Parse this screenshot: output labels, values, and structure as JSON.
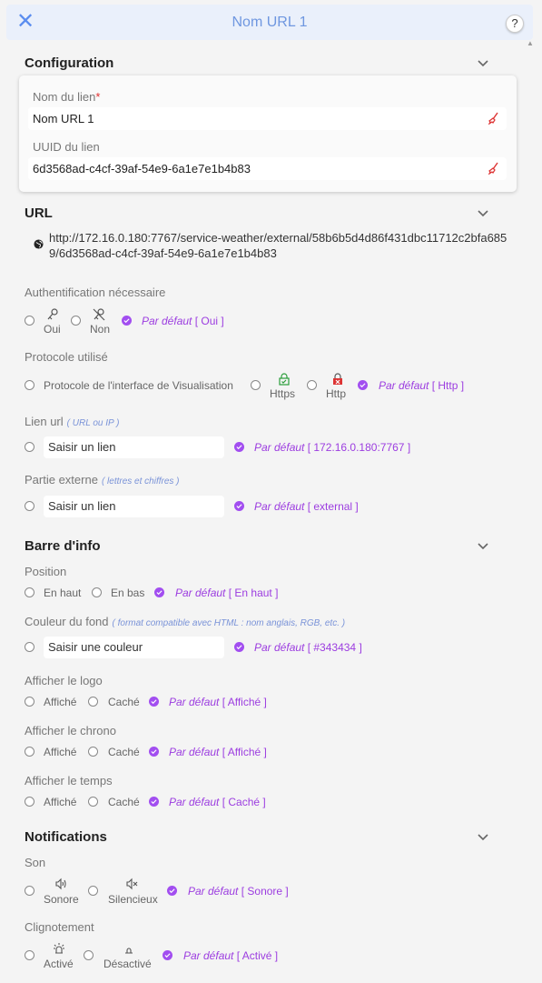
{
  "header": {
    "title": "Nom URL 1",
    "close_icon": "close-icon",
    "help_label": "?"
  },
  "config": {
    "title": "Configuration",
    "name_label": "Nom du lien",
    "required_mark": "*",
    "name_value": "Nom URL 1",
    "uuid_label": "UUID du lien",
    "uuid_value": "6d3568ad-c4cf-39af-54e9-6a1e7e1b4b83"
  },
  "url": {
    "title": "URL",
    "value": "http://172.16.0.180:7767/service-weather/external/58b6b5d4d86f431dbc11712c2bfa6859/6d3568ad-c4cf-39af-54e9-6a1e7e1b4b83"
  },
  "auth": {
    "label": "Authentification nécessaire",
    "oui": "Oui",
    "non": "Non",
    "default_prefix": "Par défaut",
    "default_value": "[ Oui ]"
  },
  "protocol": {
    "label": "Protocole utilisé",
    "interface": "Protocole de l'interface de Visualisation",
    "https": "Https",
    "http": "Http",
    "default_prefix": "Par défaut",
    "default_value": "[ Http ]"
  },
  "lien": {
    "label": "Lien url",
    "hint": "( URL ou IP )",
    "placeholder": "Saisir un lien",
    "default_prefix": "Par défaut",
    "default_value": "[ 172.16.0.180:7767 ]"
  },
  "partie": {
    "label": "Partie externe",
    "hint": "( lettres et chiffres )",
    "placeholder": "Saisir un lien",
    "default_prefix": "Par défaut",
    "default_value": "[ external ]"
  },
  "infobar": {
    "title": "Barre d'info",
    "position_label": "Position",
    "haut": "En haut",
    "bas": "En bas",
    "position_default_prefix": "Par défaut",
    "position_default": "[ En haut ]",
    "couleur_label": "Couleur du fond",
    "couleur_hint": "( format compatible avec HTML : nom anglais, RGB, etc. )",
    "couleur_placeholder": "Saisir une couleur",
    "couleur_default_prefix": "Par défaut",
    "couleur_default": "[ #343434 ]",
    "logo_label": "Afficher le logo",
    "logo_affiche": "Affiché",
    "logo_cache": "Caché",
    "logo_default_prefix": "Par défaut",
    "logo_default": "[ Affiché ]",
    "chrono_label": "Afficher le chrono",
    "chrono_affiche": "Affiché",
    "chrono_cache": "Caché",
    "chrono_default_prefix": "Par défaut",
    "chrono_default": "[ Affiché ]",
    "temps_label": "Afficher le temps",
    "temps_affiche": "Affiché",
    "temps_cache": "Caché",
    "temps_default_prefix": "Par défaut",
    "temps_default": "[ Caché ]"
  },
  "notif": {
    "title": "Notifications",
    "son_label": "Son",
    "sonore": "Sonore",
    "silencieux": "Silencieux",
    "son_default_prefix": "Par défaut",
    "son_default": "[ Sonore ]",
    "clign_label": "Clignotement",
    "active": "Activé",
    "desactive": "Désactivé",
    "clign_default_prefix": "Par défaut",
    "clign_default": "[ Activé ]"
  },
  "colors": {
    "accent": "#9c3de0",
    "header_blue": "#6f97e0",
    "check_purple": "#a24ef0",
    "hint_blue": "#7a93d8"
  }
}
